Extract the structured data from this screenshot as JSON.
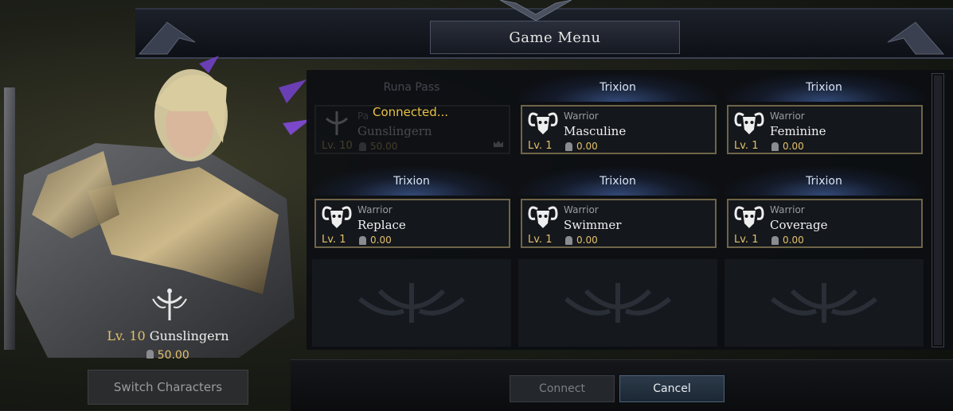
{
  "header": {
    "title": "Game Menu"
  },
  "hero": {
    "level_label": "Lv. 10",
    "name": "Gunslingern",
    "power": "50.00",
    "switch_label": "Switch Characters"
  },
  "status": {
    "connected_text": "Connected..."
  },
  "slots": [
    {
      "server": "Runa Pass",
      "class": "Pa",
      "name": "Gunslingern",
      "level": "Lv. 10",
      "power": "50.00",
      "faded": true
    },
    {
      "server": "Trixion",
      "class": "Warrior",
      "name": "Masculine",
      "level": "Lv. 1",
      "power": "0.00"
    },
    {
      "server": "Trixion",
      "class": "Warrior",
      "name": "Feminine",
      "level": "Lv. 1",
      "power": "0.00"
    },
    {
      "server": "Trixion",
      "class": "Warrior",
      "name": "Replace",
      "level": "Lv. 1",
      "power": "0.00"
    },
    {
      "server": "Trixion",
      "class": "Warrior",
      "name": "Swimmer",
      "level": "Lv. 1",
      "power": "0.00"
    },
    {
      "server": "Trixion",
      "class": "Warrior",
      "name": "Coverage",
      "level": "Lv. 1",
      "power": "0.00"
    }
  ],
  "footer": {
    "connect_label": "Connect",
    "cancel_label": "Cancel"
  },
  "colors": {
    "gold": "#e3c06a",
    "connected": "#e8c33e",
    "card_border": "#6e6548"
  }
}
